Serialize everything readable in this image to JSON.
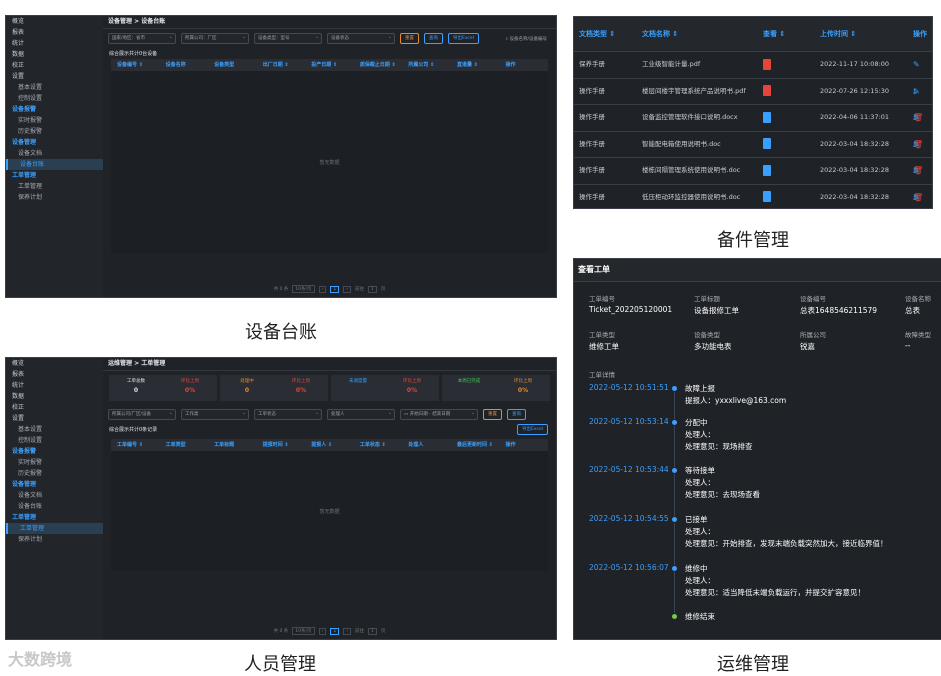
{
  "sidebar": {
    "items": [
      {
        "label": "概览",
        "type": "top"
      },
      {
        "label": "报表",
        "type": "top"
      },
      {
        "label": "统计",
        "type": "top"
      },
      {
        "label": "数据",
        "type": "top"
      },
      {
        "label": "校正",
        "type": "top"
      },
      {
        "label": "设置",
        "type": "top"
      },
      {
        "label": "基本设置",
        "type": "sub"
      },
      {
        "label": "控制设置",
        "type": "sub"
      },
      {
        "label": "设备报警",
        "type": "grp"
      },
      {
        "label": "实时报警",
        "type": "sub"
      },
      {
        "label": "历史报警",
        "type": "sub"
      },
      {
        "label": "设备管理",
        "type": "grp"
      },
      {
        "label": "设备文档",
        "type": "sub"
      },
      {
        "label": "设备台账",
        "type": "sub"
      },
      {
        "label": "工单管理",
        "type": "grp"
      },
      {
        "label": "工单管理",
        "type": "sub"
      },
      {
        "label": "保养计划",
        "type": "sub"
      }
    ]
  },
  "panel_ledger": {
    "caption": "设备台账",
    "breadcrumb": "设备管理 > 设备台账",
    "filters": [
      "国家/地区：省市",
      "所属公司：厂区",
      "设备类型：型号",
      "设备状态"
    ],
    "buttons": [
      "重置",
      "查询",
      "导出Excel"
    ],
    "search_placeholder": "设备名称/设备编号",
    "section_title": "综合展示共计0台设备",
    "columns": [
      "设备编号 ⇕",
      "设备名称",
      "设备类型",
      "出厂日期 ⇕",
      "投产日期 ⇕",
      "质保截止日期 ⇕",
      "所属公司 ⇕",
      "直道量 ⇕",
      "操作"
    ],
    "empty_text": "暂无数据",
    "pager": {
      "total": "共 0 条",
      "per_page": "10条/页",
      "pages": [
        "‹",
        "1",
        "›"
      ],
      "goto": "前往",
      "page_no": "1",
      "page_unit": "页"
    }
  },
  "panel_personnel": {
    "caption": "人员管理",
    "breadcrumb": "运维管理 > 工单管理",
    "cards": [
      [
        {
          "label": "工单总数",
          "value": "0",
          "color": "#dfe2e6"
        },
        {
          "label": "环比上周",
          "value": "0%",
          "color": "#e8443a"
        }
      ],
      [
        {
          "label": "处理中",
          "value": "0",
          "color": "#e68a2e"
        },
        {
          "label": "环比上周",
          "value": "0%",
          "color": "#e8443a"
        }
      ],
      [
        {
          "label": "未调度量",
          "value": "",
          "color": "#3aa0ff"
        },
        {
          "label": "环比上周",
          "value": "0%",
          "color": "#e8443a"
        }
      ],
      [
        {
          "label": "本周已完成",
          "value": "",
          "color": "#3cc65a"
        },
        {
          "label": "环比上周",
          "value": "0%",
          "color": "#e68a2e"
        }
      ]
    ],
    "filters": [
      "所属公司/厂区/设备",
      "工作类",
      "工单状态",
      "处理人"
    ],
    "date_start": "开始日期",
    "date_end": "结束日期",
    "buttons": [
      "重置",
      "查询"
    ],
    "export": "导出Excel",
    "section_title": "综合展示共计0条记录",
    "columns": [
      "工单编号 ⇕",
      "工单类型",
      "工单标题",
      "提报时间 ⇕",
      "提报人 ⇕",
      "工单状态 ⇕",
      "处理人",
      "最后更新时间 ⇕",
      "操作"
    ],
    "empty_text": "暂无数据",
    "pager": {
      "total": "共 0 条",
      "per_page": "10条/页",
      "pages": [
        "‹",
        "1",
        "›"
      ],
      "goto": "前往",
      "page_no": "1",
      "page_unit": "页"
    }
  },
  "panel_spares": {
    "caption": "备件管理",
    "columns": [
      "文档类型 ⇕",
      "文档名称 ⇕",
      "查看 ⇕",
      "上传时间 ⇕",
      "操作"
    ],
    "rows": [
      {
        "type": "保养手册",
        "name": "工业级智能计量.pdf",
        "ext": "pdf",
        "time": "2022-11-17 10:08:00"
      },
      {
        "type": "操作手册",
        "name": "楼层间楼宇管理系统产品说明书.pdf",
        "ext": "pdf",
        "time": "2022-07-26 12:15:30"
      },
      {
        "type": "操作手册",
        "name": "设备监控管理软件接口说明.docx",
        "ext": "doc",
        "time": "2022-04-06 11:37:01"
      },
      {
        "type": "操作手册",
        "name": "智能配电箱使用说明书.doc",
        "ext": "doc",
        "time": "2022-03-04 18:32:28"
      },
      {
        "type": "操作手册",
        "name": "楼栋间隔管理系统使用说明书.doc",
        "ext": "doc",
        "time": "2022-03-04 18:32:28"
      },
      {
        "type": "操作手册",
        "name": "低压柜动环监控器使用说明书.doc",
        "ext": "doc",
        "time": "2022-03-04 18:32:28"
      }
    ],
    "colors": {
      "pdf": "#e8443a",
      "doc": "#3aa0ff"
    }
  },
  "panel_ops": {
    "caption": "运维管理",
    "title": "查看工单",
    "fields": [
      {
        "k": "工单编号",
        "v": "Ticket_202205120001"
      },
      {
        "k": "工单标题",
        "v": "设备报修工单"
      },
      {
        "k": "设备编号",
        "v": "总表1648546211579"
      },
      {
        "k": "设备名称",
        "v": "总表"
      },
      {
        "k": "工单类型",
        "v": "维修工单"
      },
      {
        "k": "设备类型",
        "v": "多功能电表"
      },
      {
        "k": "所属公司",
        "v": "锐嘉"
      },
      {
        "k": "故障类型",
        "v": "--"
      }
    ],
    "detail_label": "工单详情",
    "timeline": [
      {
        "time": "2022-05-12 10:51:51",
        "status": "故障上报",
        "lines": [
          "提报人：yxxxlive@163.com"
        ]
      },
      {
        "time": "2022-05-12 10:53:14",
        "status": "分配中",
        "lines": [
          "处理人：",
          "处理意见：现场排查"
        ]
      },
      {
        "time": "2022-05-12 10:53:44",
        "status": "等待接单",
        "lines": [
          "处理人：",
          "处理意见：去现场查看"
        ]
      },
      {
        "time": "2022-05-12 10:54:55",
        "status": "已接单",
        "lines": [
          "处理人：",
          "处理意见：开始排查，发现末端负载突然加大，接近临界值！"
        ]
      },
      {
        "time": "2022-05-12 10:56:07",
        "status": "维修中",
        "lines": [
          "处理人：",
          "处理意见：适当降低末端负载运行，并提交扩容意见！"
        ]
      },
      {
        "time": "",
        "status": "维修结束",
        "lines": []
      }
    ]
  },
  "watermark": "大数跨境"
}
